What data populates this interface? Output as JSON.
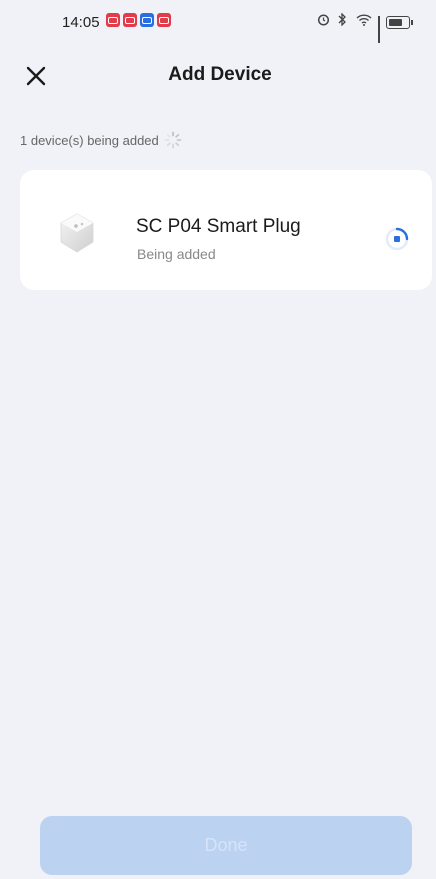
{
  "status_bar": {
    "time": "14:05"
  },
  "header": {
    "title": "Add Device",
    "close_icon": "close-icon"
  },
  "progress": {
    "text": "1 device(s) being added"
  },
  "device": {
    "name": "SC P04 Smart Plug",
    "status": "Being added"
  },
  "footer": {
    "done_label": "Done"
  },
  "colors": {
    "background": "#f1f2f7",
    "card": "#ffffff",
    "accent": "#2a6fe0",
    "done_button_disabled": "#bcd2f1"
  }
}
